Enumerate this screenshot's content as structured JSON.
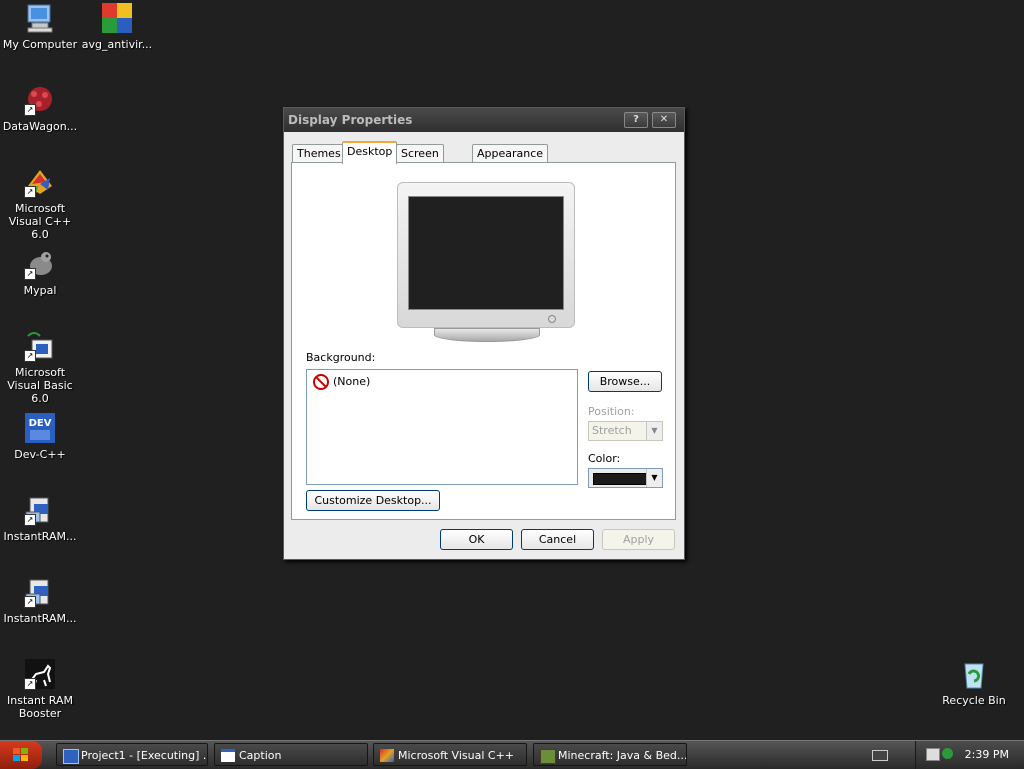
{
  "desktop": {
    "icons": [
      {
        "label": "My Computer"
      },
      {
        "label": "avg_antivir..."
      },
      {
        "label": "DataWagon..."
      },
      {
        "label": "Microsoft Visual C++ 6.0"
      },
      {
        "label": "Mypal"
      },
      {
        "label": "Microsoft Visual Basic 6.0"
      },
      {
        "label": "Dev-C++"
      },
      {
        "label": "InstantRAM..."
      },
      {
        "label": "InstantRAM..."
      },
      {
        "label": "Instant RAM Booster"
      },
      {
        "label": "Recycle Bin"
      }
    ]
  },
  "dialog": {
    "title": "Display Properties",
    "help_btn": "?",
    "close_btn": "✕",
    "tabs": [
      {
        "label": "Themes"
      },
      {
        "label": "Desktop"
      },
      {
        "label": "Screen Saver"
      },
      {
        "label": "Appearance"
      }
    ],
    "background_label": "Background:",
    "background_items": [
      {
        "label": "(None)"
      }
    ],
    "browse_btn": "Browse...",
    "position_label": "Position:",
    "position_value": "Stretch",
    "color_label": "Color:",
    "color_value": "#1a1a1a",
    "customize_btn": "Customize Desktop...",
    "ok_btn": "OK",
    "cancel_btn": "Cancel",
    "apply_btn": "Apply"
  },
  "taskbar": {
    "tasks": [
      {
        "label": "Project1 - [Executing] ..."
      },
      {
        "label": "Caption"
      },
      {
        "label": "Microsoft Visual C++"
      },
      {
        "label": "Minecraft: Java & Bed..."
      }
    ],
    "clock": "2:39 PM"
  }
}
